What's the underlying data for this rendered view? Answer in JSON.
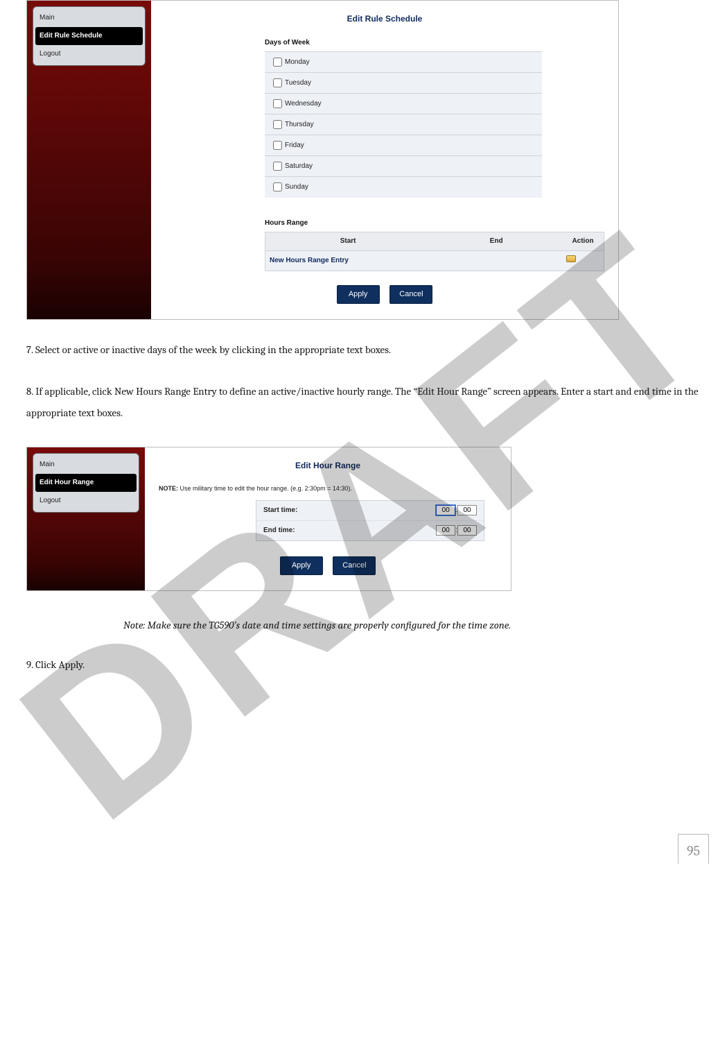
{
  "watermark": "DRAFT",
  "shot1": {
    "menu": {
      "items": [
        "Main",
        "Edit Rule Schedule",
        "Logout"
      ],
      "activeIndex": 1
    },
    "title": "Edit Rule Schedule",
    "daysLabel": "Days of Week",
    "days": [
      "Monday",
      "Tuesday",
      "Wednesday",
      "Thursday",
      "Friday",
      "Saturday",
      "Sunday"
    ],
    "hoursLabel": "Hours Range",
    "hoursCols": {
      "start": "Start",
      "end": "End",
      "action": "Action"
    },
    "hoursEntry": "New Hours Range Entry",
    "apply": "Apply",
    "cancel": "Cancel"
  },
  "step7": "7.  Select or active or inactive days of the week by clicking in the appropriate text boxes.",
  "step8": "8.  If applicable, click New Hours Range Entry to define an active/inactive hourly range. The “Edit Hour Range” screen appears. Enter a start and end time in the appropriate text boxes.",
  "shot2": {
    "menu": {
      "items": [
        "Main",
        "Edit Hour Range",
        "Logout"
      ],
      "activeIndex": 1
    },
    "title": "Edit Hour Range",
    "noteBold": "NOTE:",
    "note": " Use military time to edit the hour range. (e.g. 2:30pm = 14:30).",
    "startLabel": "Start time:",
    "endLabel": "End time:",
    "start": {
      "hh": "00",
      "sep": " : ",
      "mm": "00"
    },
    "end": {
      "hh": "00",
      "sep": " : ",
      "mm": "00"
    },
    "apply": "Apply",
    "cancel": "Cancel"
  },
  "noteQuote": "Note: Make sure the TG590’s date and time settings are properly configured for the time zone.",
  "step9": "9.  Click Apply.",
  "pageNum": "95"
}
